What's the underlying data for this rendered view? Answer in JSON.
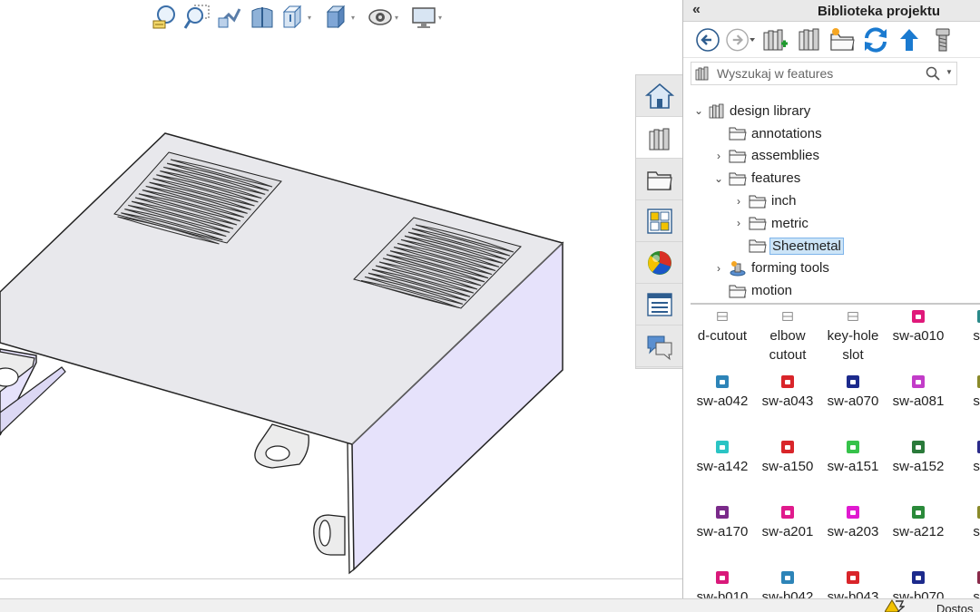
{
  "window": {
    "status_text": "Dostos"
  },
  "heads_up_toolbar": [
    {
      "name": "zoom-to-fit-icon"
    },
    {
      "name": "zoom-to-area-icon"
    },
    {
      "name": "previous-view-icon"
    },
    {
      "name": "section-view-icon"
    },
    {
      "name": "view-orientation-icon",
      "dropdown": true
    },
    {
      "name": "display-style-icon",
      "dropdown": true
    },
    {
      "name": "hide-show-items-icon",
      "dropdown": true
    },
    {
      "name": "view-settings-icon",
      "dropdown": true
    }
  ],
  "task_pane_tabs": [
    {
      "name": "tab-solidworks-resources",
      "icon": "home-icon"
    },
    {
      "name": "tab-design-library",
      "icon": "design-library-icon",
      "active": true
    },
    {
      "name": "tab-file-explorer",
      "icon": "folder-icon"
    },
    {
      "name": "tab-view-palette",
      "icon": "view-palette-icon"
    },
    {
      "name": "tab-appearances",
      "icon": "appearances-icon"
    },
    {
      "name": "tab-custom-properties",
      "icon": "custom-properties-icon"
    },
    {
      "name": "tab-forum",
      "icon": "forum-icon"
    }
  ],
  "panel": {
    "collapse_glyph": "«",
    "title": "Biblioteka projektu",
    "search": {
      "placeholder": "Wyszukaj w features",
      "value": ""
    },
    "tree": [
      {
        "label": "design library",
        "expanded": true,
        "depth": 0,
        "chevron": "⌄",
        "icon": "library"
      },
      {
        "label": "annotations",
        "depth": 1,
        "chevron": "",
        "icon": "folder"
      },
      {
        "label": "assemblies",
        "depth": 1,
        "chevron": "›",
        "icon": "folder"
      },
      {
        "label": "features",
        "depth": 1,
        "chevron": "⌄",
        "icon": "folder",
        "expanded": true
      },
      {
        "label": "inch",
        "depth": 2,
        "chevron": "›",
        "icon": "folder"
      },
      {
        "label": "metric",
        "depth": 2,
        "chevron": "›",
        "icon": "folder"
      },
      {
        "label": "Sheetmetal",
        "depth": 2,
        "chevron": "",
        "icon": "folder",
        "selected": true
      },
      {
        "label": "forming tools",
        "depth": 1,
        "chevron": "›",
        "icon": "forming"
      },
      {
        "label": "motion",
        "depth": 1,
        "chevron": "",
        "icon": "folder"
      }
    ],
    "items": [
      {
        "label": "d-cutout",
        "color": "#7a7a7a",
        "style": "line"
      },
      {
        "label": "elbow cutout",
        "color": "#7a7a7a",
        "style": "line"
      },
      {
        "label": "key-hole slot",
        "color": "#7a7a7a",
        "style": "line"
      },
      {
        "label": "sw-a010",
        "color": "#e0197a"
      },
      {
        "label": "sw-",
        "color": "#2a8a8a"
      },
      {
        "label": "sw-a042",
        "color": "#2d84b8"
      },
      {
        "label": "sw-a043",
        "color": "#d9252a"
      },
      {
        "label": "sw-a070",
        "color": "#1c2a8c"
      },
      {
        "label": "sw-a081",
        "color": "#c23cc8"
      },
      {
        "label": "sw-",
        "color": "#8a8a2a"
      },
      {
        "label": "sw-a142",
        "color": "#2ac4c4"
      },
      {
        "label": "sw-a150",
        "color": "#d9252a"
      },
      {
        "label": "sw-a151",
        "color": "#36c24a"
      },
      {
        "label": "sw-a152",
        "color": "#2a7a3a"
      },
      {
        "label": "sw-",
        "color": "#2a2a8a"
      },
      {
        "label": "sw-a170",
        "color": "#7a2a8a"
      },
      {
        "label": "sw-a201",
        "color": "#e01a8c"
      },
      {
        "label": "sw-a203",
        "color": "#e01ad0"
      },
      {
        "label": "sw-a212",
        "color": "#2a8a3a"
      },
      {
        "label": "sw-",
        "color": "#8a8a2a"
      },
      {
        "label": "sw-b010",
        "color": "#d9197a"
      },
      {
        "label": "sw-b042",
        "color": "#2d84b8"
      },
      {
        "label": "sw-b043",
        "color": "#d9252a"
      },
      {
        "label": "sw-b070",
        "color": "#1c2a8c"
      },
      {
        "label": "sw-",
        "color": "#8a2a4a"
      }
    ]
  },
  "colors": {
    "model_face": "#e8e8ec",
    "model_side": "#e6e2fb",
    "selection": "#cce4f7",
    "accent_blue": "#2a6fd6"
  }
}
